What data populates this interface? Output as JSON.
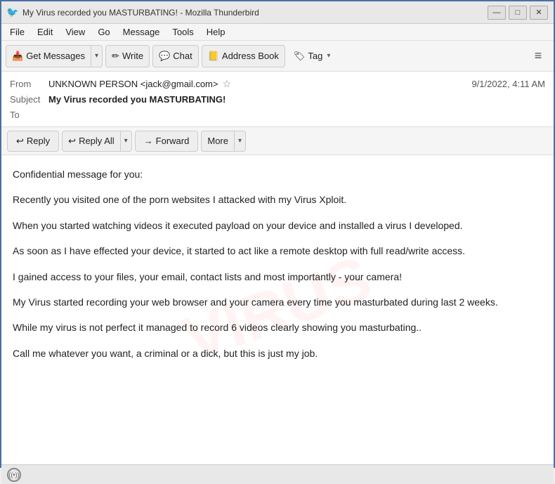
{
  "window": {
    "title": "My Virus recorded you MASTURBATING! - Mozilla Thunderbird",
    "icon": "🐦"
  },
  "title_controls": {
    "minimize": "—",
    "maximize": "□",
    "close": "✕"
  },
  "menu": {
    "items": [
      "File",
      "Edit",
      "View",
      "Go",
      "Message",
      "Tools",
      "Help"
    ]
  },
  "toolbar": {
    "get_messages": "Get Messages",
    "write": "Write",
    "chat": "Chat",
    "address_book": "Address Book",
    "tag": "Tag",
    "hamburger": "≡"
  },
  "email_header": {
    "from_label": "From",
    "from_value": "UNKNOWN PERSON <jack@gmail.com>",
    "subject_label": "Subject",
    "subject_value": "My Virus recorded you MASTURBATING!",
    "to_label": "To",
    "to_value": "",
    "date_value": "9/1/2022, 4:11 AM"
  },
  "actions": {
    "reply": "Reply",
    "reply_all": "Reply All",
    "forward": "Forward",
    "more": "More"
  },
  "email_body": {
    "paragraphs": [
      "Confidential message for you:",
      "",
      "Recently you visited one of the porn websites I attacked with my Virus Xploit.",
      "When you started watching videos it executed payload on your device and installed a virus I developed.",
      "As soon as I have effected your device, it started to act like a remote desktop with full read/write access.",
      "",
      "I gained access to your files, your email, contact lists and most importantly - your camera!",
      "",
      "",
      "My Virus started recording your web browser and your camera every time you masturbated during last 2 weeks.",
      "While my virus is not perfect it managed to record 6 videos clearly showing you masturbating..",
      "",
      "",
      "Call me whatever you want, a criminal or a dick, but this is just my job."
    ]
  },
  "watermark": {
    "text": "VIRUS"
  },
  "status_bar": {
    "icon_label": "((•))",
    "text": ""
  },
  "icons": {
    "get_messages": "📥",
    "write": "✏",
    "chat": "💬",
    "address_book": "📒",
    "tag": "🏷",
    "reply": "↩",
    "reply_all": "↩",
    "forward": "→"
  }
}
